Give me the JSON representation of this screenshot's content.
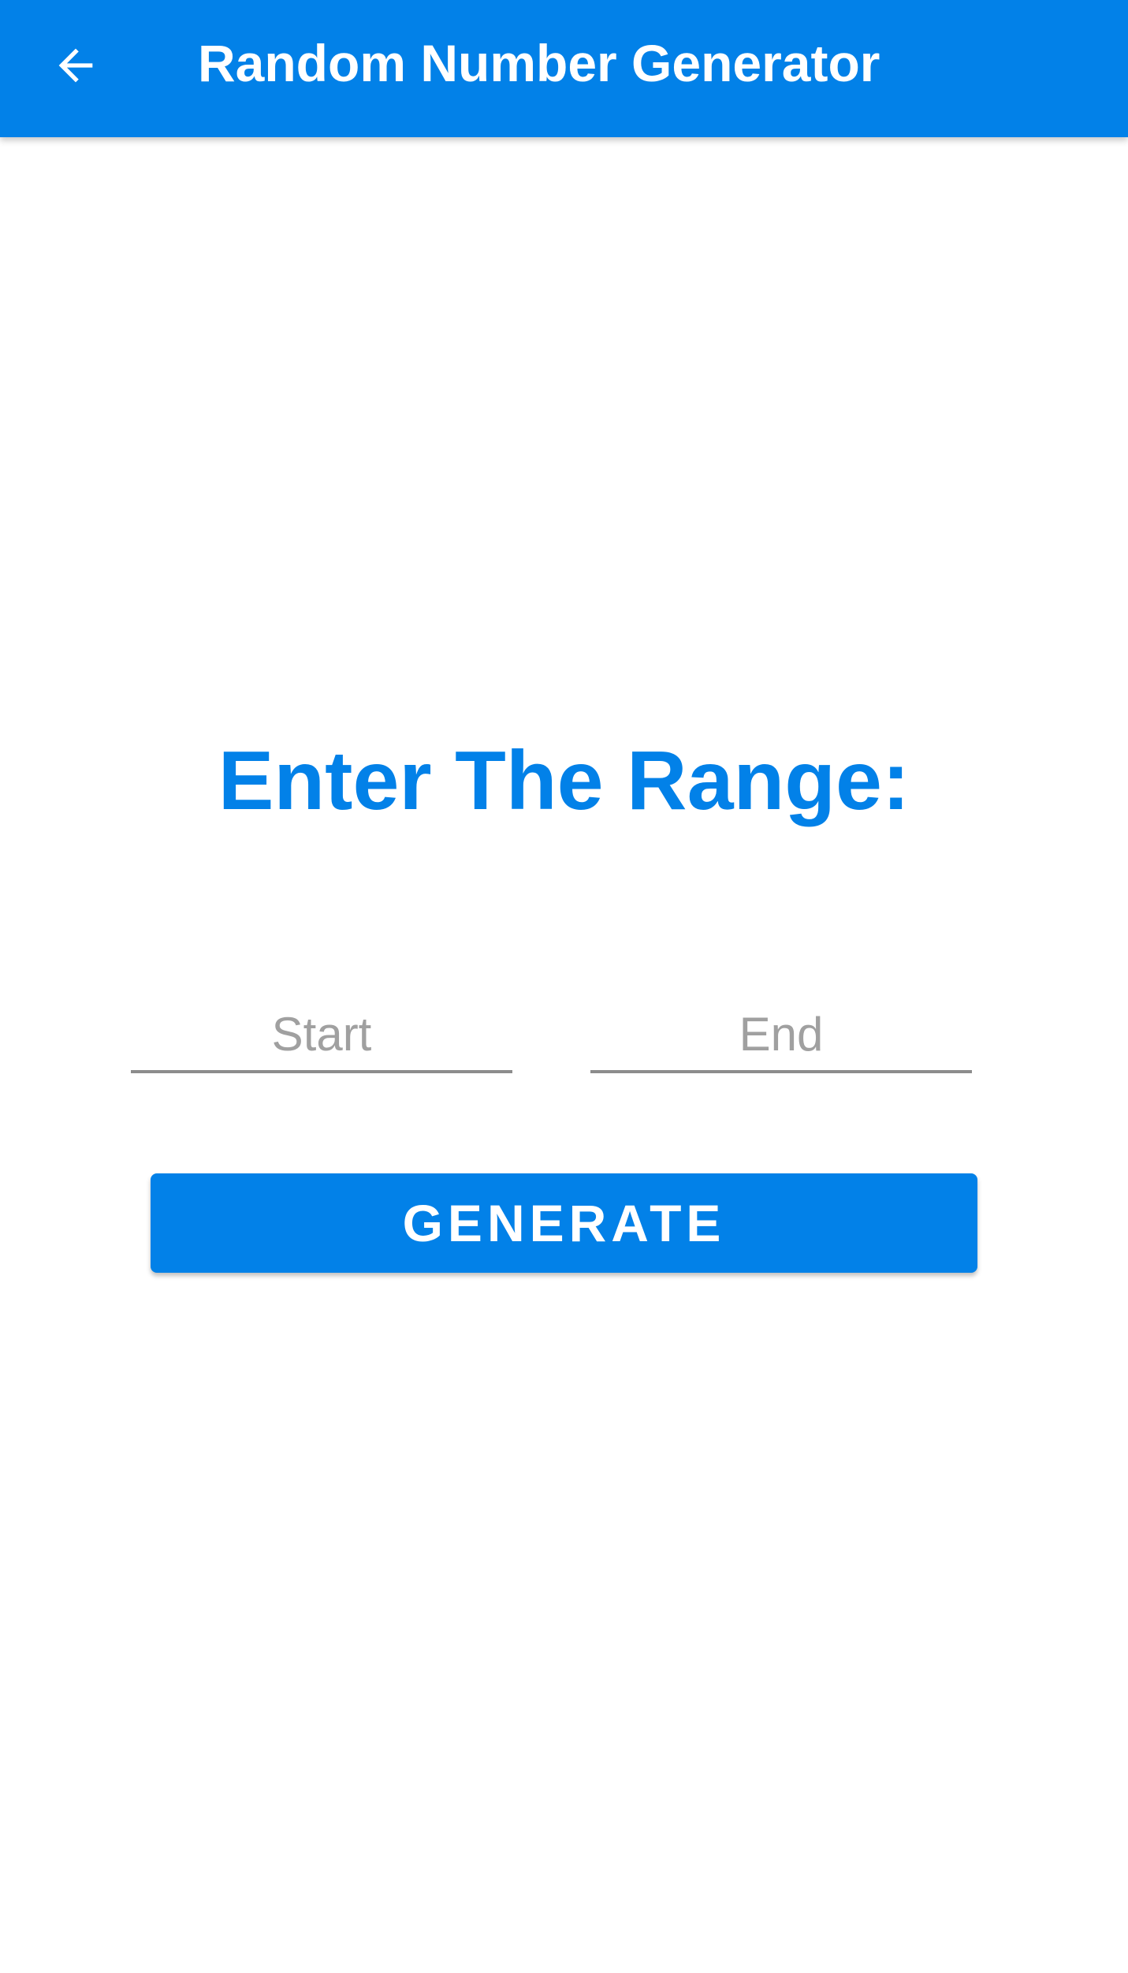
{
  "app_bar": {
    "back_icon": "arrow-left-icon",
    "title": "Random Number Generator",
    "color": "#0281E8"
  },
  "main": {
    "heading": "Enter The Range:",
    "start_field": {
      "value": "",
      "placeholder": "Start"
    },
    "end_field": {
      "value": "",
      "placeholder": "End"
    },
    "generate_label": "GENERATE"
  },
  "colors": {
    "accent": "#0281E8",
    "background": "#FFFFFF",
    "placeholder": "#A0A0A0",
    "underline": "#8C8C8C"
  }
}
